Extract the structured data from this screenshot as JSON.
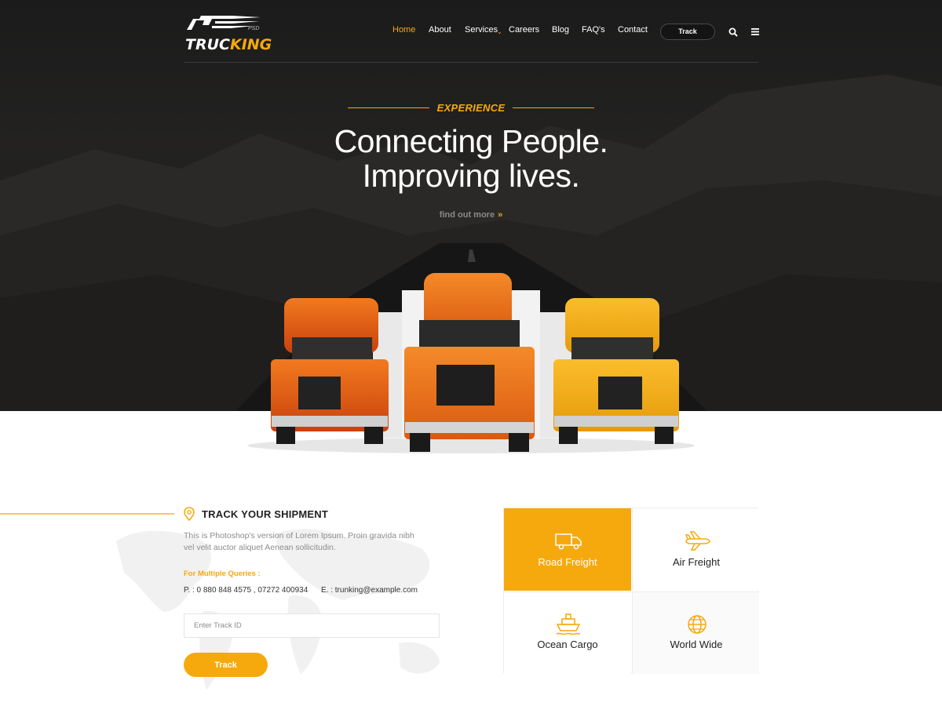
{
  "brand": {
    "logo_main": "TRUC",
    "logo_accent": "KING",
    "logo_sub": "PSD"
  },
  "nav": {
    "items": [
      {
        "label": "Home",
        "active": true
      },
      {
        "label": "About"
      },
      {
        "label": "Services",
        "has_dropdown": true
      },
      {
        "label": "Careers"
      },
      {
        "label": "Blog"
      },
      {
        "label": "FAQ's"
      },
      {
        "label": "Contact"
      }
    ],
    "track_button": "Track",
    "search_icon": "search-icon",
    "menu_icon": "hamburger-menu-icon"
  },
  "hero": {
    "eyebrow": "EXPERIENCE",
    "headline_line1": "Connecting People.",
    "headline_line2": "Improving lives.",
    "cta": "find out more",
    "cta_icon": "double-chevron-right-icon"
  },
  "track": {
    "title": "TRACK YOUR SHIPMENT",
    "description": "This is Photoshop's version  of Lorem Ipsum. Proin gravida nibh vel velit auctor aliquet Aenean sollicitudin.",
    "queries_label": "For Multiple Queries :",
    "phone": "P. : 0 880 848 4575 , 07272 400934",
    "email": "E. : trunking@example.com",
    "input_placeholder": "Enter Track ID",
    "input_value": "",
    "submit_label": "Track"
  },
  "services": [
    {
      "label": "Road Freight",
      "icon": "truck-icon",
      "active": true
    },
    {
      "label": "Air Freight",
      "icon": "airplane-icon",
      "active": false
    },
    {
      "label": "Ocean Cargo",
      "icon": "ship-icon",
      "active": false
    },
    {
      "label": "World Wide",
      "icon": "globe-icon",
      "active": false
    }
  ],
  "colors": {
    "accent": "#f6a90c",
    "hero_bg": "#1e1e1e",
    "text_dark": "#222222",
    "text_muted": "#8c8c8c"
  }
}
